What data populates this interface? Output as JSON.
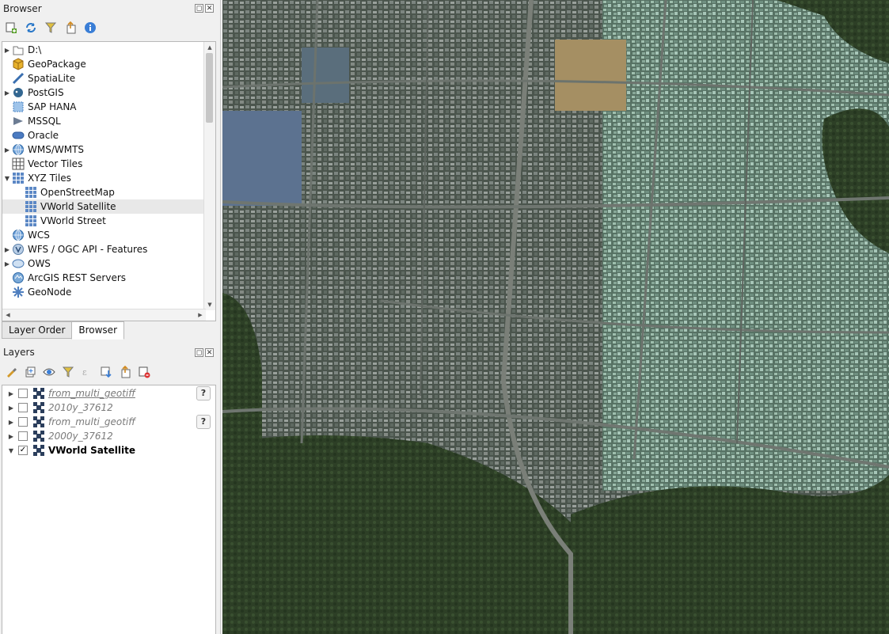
{
  "browser": {
    "title": "Browser",
    "toolbar_icons": [
      "add-layer-icon",
      "refresh-icon",
      "filter-icon",
      "collapse-all-icon",
      "info-icon"
    ],
    "items": [
      {
        "label": "D:\\",
        "icon": "folder-icon",
        "expandable": true,
        "indent": 0
      },
      {
        "label": "GeoPackage",
        "icon": "geopackage-icon",
        "expandable": false,
        "indent": 0
      },
      {
        "label": "SpatiaLite",
        "icon": "spatialite-icon",
        "expandable": false,
        "indent": 0
      },
      {
        "label": "PostGIS",
        "icon": "postgis-icon",
        "expandable": true,
        "indent": 0
      },
      {
        "label": "SAP HANA",
        "icon": "sap-hana-icon",
        "expandable": false,
        "indent": 0
      },
      {
        "label": "MSSQL",
        "icon": "mssql-icon",
        "expandable": false,
        "indent": 0
      },
      {
        "label": "Oracle",
        "icon": "oracle-icon",
        "expandable": false,
        "indent": 0
      },
      {
        "label": "WMS/WMTS",
        "icon": "globe-icon",
        "expandable": true,
        "indent": 0
      },
      {
        "label": "Vector Tiles",
        "icon": "grid-icon",
        "expandable": false,
        "indent": 0
      },
      {
        "label": "XYZ Tiles",
        "icon": "tiles-icon",
        "expandable": true,
        "expanded": true,
        "indent": 0
      },
      {
        "label": "OpenStreetMap",
        "icon": "tiles-icon",
        "expandable": false,
        "indent": 1
      },
      {
        "label": "VWorld Satellite",
        "icon": "tiles-icon",
        "expandable": false,
        "indent": 1,
        "selected": true
      },
      {
        "label": "VWorld Street",
        "icon": "tiles-icon",
        "expandable": false,
        "indent": 1
      },
      {
        "label": "WCS",
        "icon": "globe-icon",
        "expandable": false,
        "indent": 0
      },
      {
        "label": "WFS / OGC API - Features",
        "icon": "wfs-icon",
        "expandable": true,
        "indent": 0
      },
      {
        "label": "OWS",
        "icon": "ows-icon",
        "expandable": true,
        "indent": 0
      },
      {
        "label": "ArcGIS REST Servers",
        "icon": "arcgis-icon",
        "expandable": false,
        "indent": 0
      },
      {
        "label": "GeoNode",
        "icon": "geonode-icon",
        "expandable": false,
        "indent": 0
      }
    ]
  },
  "tabs": [
    {
      "label": "Layer Order",
      "active": false
    },
    {
      "label": "Browser",
      "active": true
    }
  ],
  "layers": {
    "title": "Layers",
    "toolbar_icons": [
      "style-icon",
      "add-group-icon",
      "visibility-icon",
      "filter-legend-icon",
      "expression-filter-icon",
      "expand-all-icon",
      "collapse-all-icon",
      "remove-layer-icon"
    ],
    "items": [
      {
        "label": "from_multi_geotiff",
        "checked": false,
        "underlined": true,
        "active": false,
        "warning": "?"
      },
      {
        "label": "2010y_37612",
        "checked": false,
        "underlined": false,
        "active": false,
        "warning": ""
      },
      {
        "label": "from_multi_geotiff",
        "checked": false,
        "underlined": false,
        "active": false,
        "warning": "?"
      },
      {
        "label": "2000y_37612",
        "checked": false,
        "underlined": false,
        "active": false,
        "warning": ""
      },
      {
        "label": "VWorld Satellite",
        "checked": true,
        "underlined": false,
        "active": true,
        "warning": ""
      }
    ]
  },
  "map": {
    "layer": "VWorld Satellite",
    "checkmark": "✓"
  }
}
